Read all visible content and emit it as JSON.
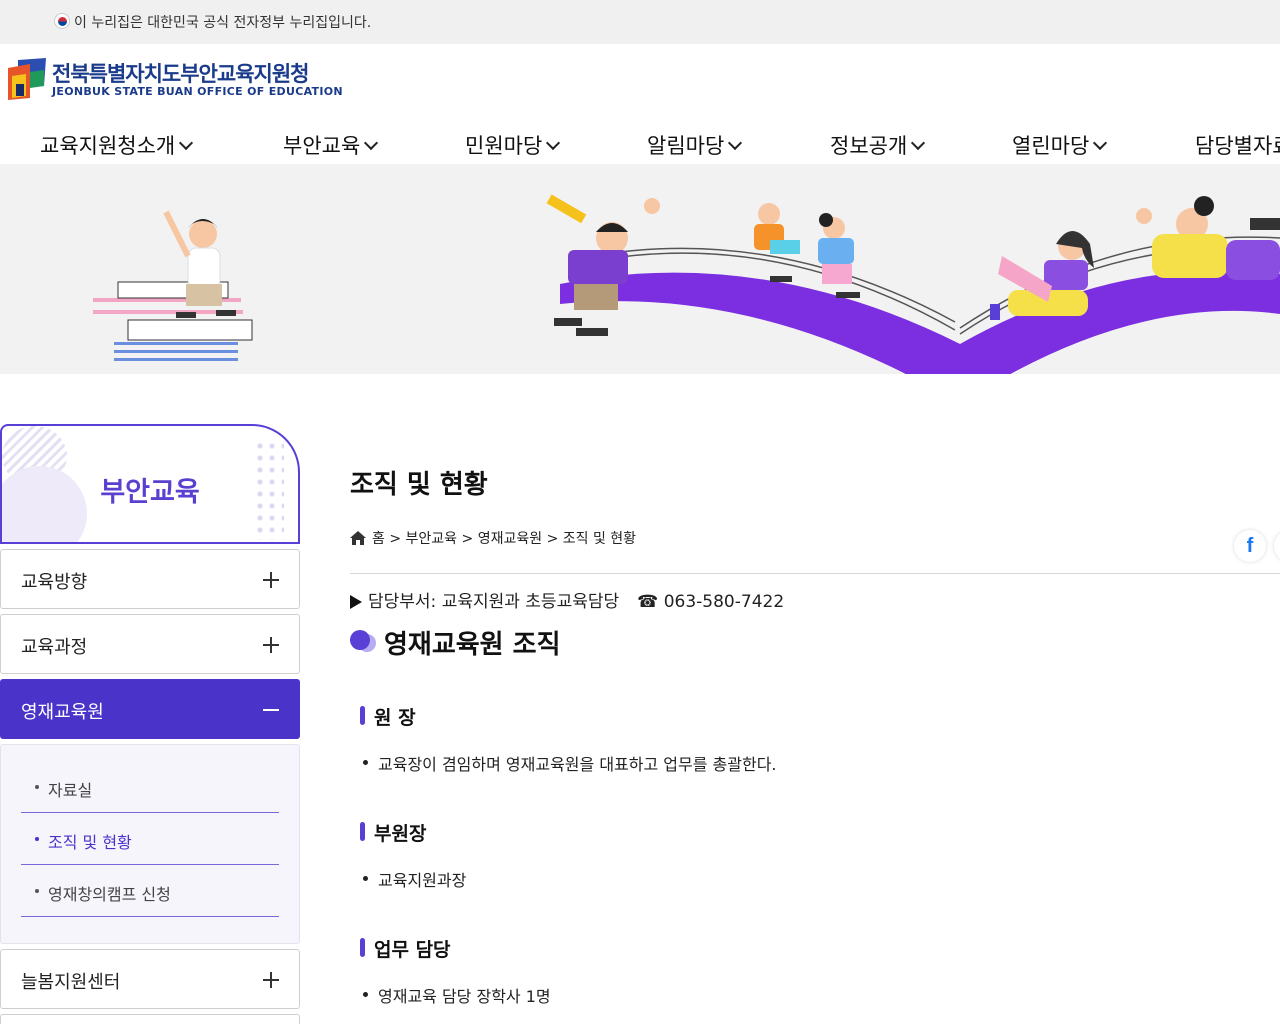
{
  "gov_banner": {
    "text": "이 누리집은 대한민국 공식 전자정부 누리집입니다."
  },
  "header": {
    "logo_ko": "전북특별자치도부안교육지원청",
    "logo_en": "JEONBUK STATE BUAN OFFICE OF EDUCATION"
  },
  "gnb": {
    "items": [
      {
        "label": "교육지원청소개"
      },
      {
        "label": "부안교육"
      },
      {
        "label": "민원마당"
      },
      {
        "label": "알림마당"
      },
      {
        "label": "정보공개"
      },
      {
        "label": "열린마당"
      },
      {
        "label": "담당별자료"
      }
    ]
  },
  "sidebar": {
    "title": "부안교육",
    "items": [
      {
        "label": "교육방향",
        "state": "collapsed"
      },
      {
        "label": "교육과정",
        "state": "collapsed"
      },
      {
        "label": "영재교육원",
        "state": "expanded"
      },
      {
        "label": "늘봄지원센터",
        "state": "collapsed"
      }
    ],
    "sub_items": [
      {
        "label": "자료실"
      },
      {
        "label": "조직 및 현황",
        "current": true
      },
      {
        "label": "영재창의캠프 신청"
      }
    ],
    "accent_color": "#4a33c9"
  },
  "content": {
    "page_title": "조직 및 현황",
    "breadcrumb": [
      "홈",
      "부안교육",
      "영재교육원",
      "조직 및 현황"
    ],
    "breadcrumb_sep": ">",
    "dept_label": "담당부서: 교육지원과 초등교육담당",
    "dept_tel": "☎ 063-580-7422",
    "section_title": "영재교육원 조직",
    "sections": [
      {
        "heading": "원 장",
        "items": [
          "교육장이 겸임하며 영재교육원을 대표하고 업무를 총괄한다."
        ]
      },
      {
        "heading": "부원장",
        "items": [
          "교육지원과장"
        ]
      },
      {
        "heading": "업무 담당",
        "items": [
          "영재교육 담당 장학사 1명"
        ]
      }
    ],
    "share": {
      "facebook_icon": "f"
    }
  },
  "icons": {
    "home": "home-icon",
    "facebook": "facebook-icon",
    "chevron": "chevron-down-icon",
    "plus": "plus-icon",
    "minus": "minus-icon"
  }
}
